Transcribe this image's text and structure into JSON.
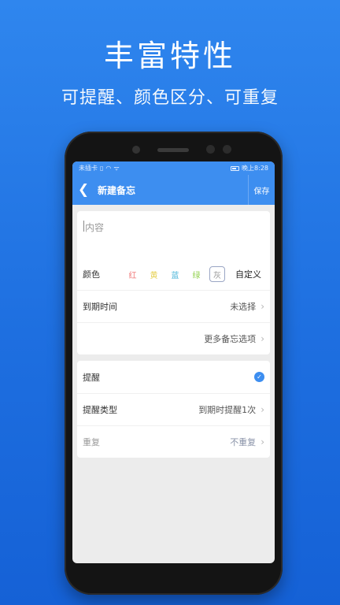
{
  "promo": {
    "title": "丰富特性",
    "subtitle": "可提醒、颜色区分、可重复"
  },
  "status_bar": {
    "left": "未插卡",
    "time": "晚上8:28"
  },
  "app_bar": {
    "back": "❮",
    "title": "新建备忘",
    "save_label": "保存"
  },
  "content": {
    "placeholder": "内容"
  },
  "color_row": {
    "label": "颜色",
    "options": [
      {
        "label": "红",
        "color": "#f07a7a"
      },
      {
        "label": "黄",
        "color": "#e6cf4e"
      },
      {
        "label": "蓝",
        "color": "#48b4d8"
      },
      {
        "label": "绿",
        "color": "#8fd04a"
      },
      {
        "label": "灰",
        "color": "#9a9a9a"
      }
    ],
    "selected": "灰",
    "custom_label": "自定义"
  },
  "due_row": {
    "label": "到期时间",
    "value": "未选择"
  },
  "more_row": {
    "value": "更多备忘选项"
  },
  "remind_row": {
    "label": "提醒",
    "checked": true
  },
  "remind_type_row": {
    "label": "提醒类型",
    "value": "到期时提醒1次"
  },
  "repeat_row": {
    "label": "重复",
    "value": "不重复"
  },
  "icons": {
    "chevron": "›",
    "check": "✓"
  }
}
